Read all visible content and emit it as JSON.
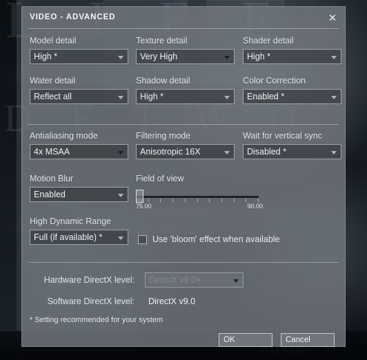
{
  "background": {
    "title_top": "L  I  F  E",
    "title_bottom": "D E    T W O"
  },
  "watermark": {
    "brand": "AMD"
  },
  "dialog": {
    "title": "VIDEO - ADVANCED",
    "close_icon": "close-icon",
    "fields": [
      {
        "label": "Model detail",
        "value": "High *"
      },
      {
        "label": "Texture detail",
        "value": "Very High"
      },
      {
        "label": "Shader detail",
        "value": "High *"
      },
      {
        "label": "Water detail",
        "value": "Reflect all"
      },
      {
        "label": "Shadow detail",
        "value": "High *"
      },
      {
        "label": "Color Correction",
        "value": "Enabled *"
      },
      {
        "label": "Antialiasing mode",
        "value": "4x MSAA"
      },
      {
        "label": "Filtering mode",
        "value": "Anisotropic 16X"
      },
      {
        "label": "Wait for vertical sync",
        "value": "Disabled *"
      },
      {
        "label": "Motion Blur",
        "value": "Enabled"
      },
      {
        "label": "High Dynamic Range",
        "value": "Full (if available) *"
      }
    ],
    "slider": {
      "label": "Field of view",
      "min_label": "75.00",
      "max_label": "90.00",
      "min": 75.0,
      "max": 90.0,
      "value": 75.0,
      "ticks": 10
    },
    "checkbox": {
      "label": "Use 'bloom' effect when available",
      "checked": false
    },
    "directx": {
      "hardware_label": "Hardware DirectX level:",
      "hardware_value": "DirectX v9.0+",
      "software_label": "Software DirectX level:",
      "software_value": "DirectX v9.0"
    },
    "footnote": "* Setting recommended for your system",
    "buttons": {
      "ok": "OK",
      "cancel": "Cancel"
    }
  }
}
